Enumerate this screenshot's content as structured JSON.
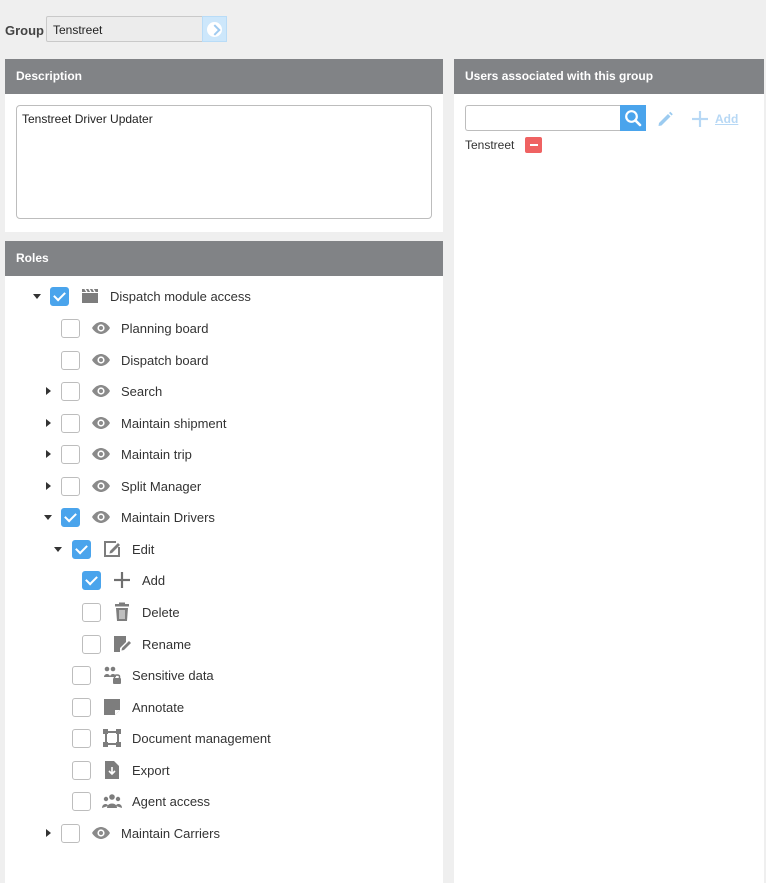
{
  "group": {
    "label": "Group",
    "value": "Tenstreet"
  },
  "description": {
    "header": "Description",
    "text": "Tenstreet Driver Updater"
  },
  "users": {
    "header": "Users associated with this group",
    "search_placeholder": "",
    "add_label": "Add",
    "items": [
      {
        "name": "Tenstreet"
      }
    ]
  },
  "roles": {
    "header": "Roles",
    "nodes": [
      {
        "label": "Dispatch module access",
        "icon": "clapperboard-icon",
        "checked": true,
        "expand": "down"
      },
      {
        "label": "Planning board",
        "icon": "eye-icon",
        "checked": false,
        "expand": "none"
      },
      {
        "label": "Dispatch board",
        "icon": "eye-icon",
        "checked": false,
        "expand": "none"
      },
      {
        "label": "Search",
        "icon": "eye-icon",
        "checked": false,
        "expand": "right"
      },
      {
        "label": "Maintain shipment",
        "icon": "eye-icon",
        "checked": false,
        "expand": "right"
      },
      {
        "label": "Maintain trip",
        "icon": "eye-icon",
        "checked": false,
        "expand": "right"
      },
      {
        "label": "Split Manager",
        "icon": "eye-icon",
        "checked": false,
        "expand": "right"
      },
      {
        "label": "Maintain Drivers",
        "icon": "eye-icon",
        "checked": true,
        "expand": "down"
      },
      {
        "label": "Edit",
        "icon": "edit-icon",
        "checked": true,
        "expand": "down"
      },
      {
        "label": "Add",
        "icon": "plus-icon",
        "checked": true,
        "expand": "none"
      },
      {
        "label": "Delete",
        "icon": "trash-icon",
        "checked": false,
        "expand": "none"
      },
      {
        "label": "Rename",
        "icon": "rename-icon",
        "checked": false,
        "expand": "none"
      },
      {
        "label": "Sensitive data",
        "icon": "people-lock-icon",
        "checked": false,
        "expand": "none"
      },
      {
        "label": "Annotate",
        "icon": "sticky-note-icon",
        "checked": false,
        "expand": "none"
      },
      {
        "label": "Document management",
        "icon": "frame-icon",
        "checked": false,
        "expand": "none"
      },
      {
        "label": "Export",
        "icon": "export-file-icon",
        "checked": false,
        "expand": "none"
      },
      {
        "label": "Agent access",
        "icon": "users-icon",
        "checked": false,
        "expand": "none"
      },
      {
        "label": "Maintain Carriers",
        "icon": "eye-icon",
        "checked": false,
        "expand": "right"
      }
    ]
  }
}
